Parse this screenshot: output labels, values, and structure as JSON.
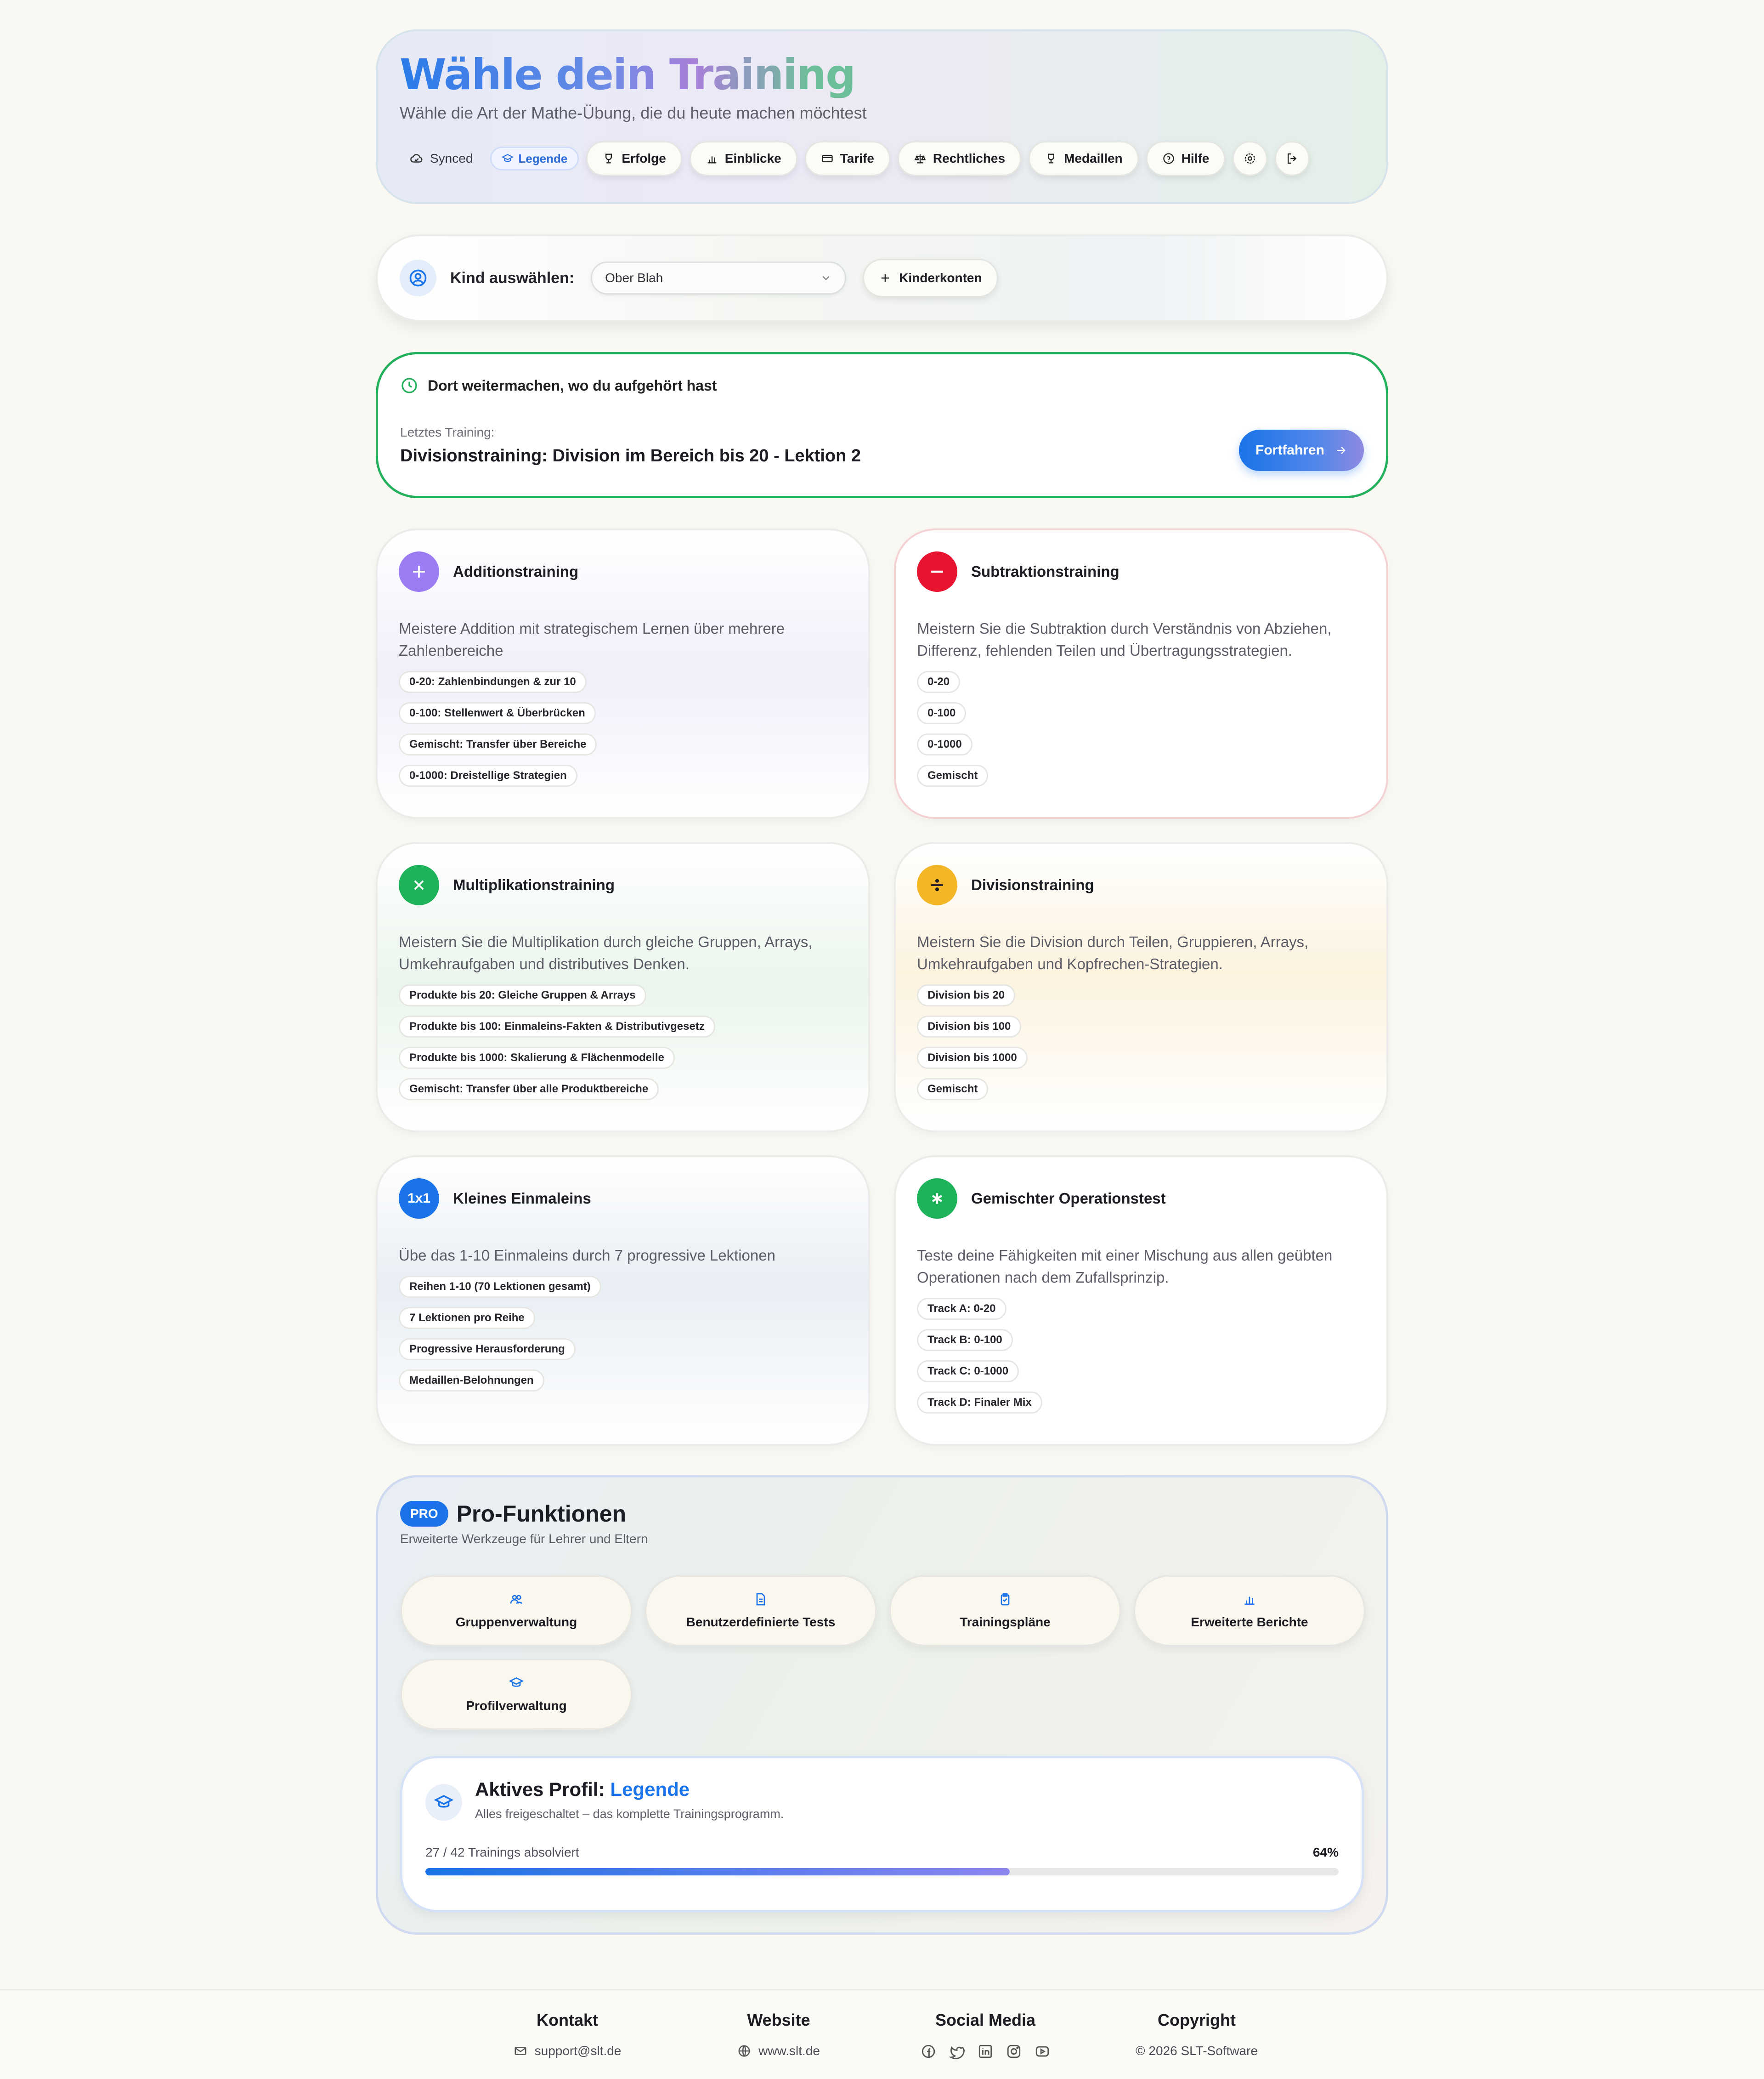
{
  "header": {
    "title": "Wähle dein Training",
    "subtitle": "Wähle die Art der Mathe-Übung, die du heute machen möchtest",
    "synced_label": "Synced",
    "legende_label": "Legende",
    "nav": {
      "erfolge": "Erfolge",
      "einblicke": "Einblicke",
      "tarife": "Tarife",
      "rechtliches": "Rechtliches",
      "medaillen": "Medaillen",
      "hilfe": "Hilfe"
    }
  },
  "child_select": {
    "label": "Kind auswählen:",
    "selected": "Ober Blah",
    "kinderkonten_label": "Kinderkonten"
  },
  "resume": {
    "heading": "Dort weitermachen, wo du aufgehört hast",
    "last_label": "Letztes Training:",
    "last_title": "Divisionstraining: Division im Bereich bis 20 - Lektion 2",
    "continue_label": "Fortfahren"
  },
  "trainings": [
    {
      "title": "Additionstraining",
      "description": "Meistere Addition mit strategischem Lernen über mehrere Zahlenbereiche",
      "chips": [
        "0-20: Zahlenbindungen & zur 10",
        "0-100: Stellenwert & Überbrücken",
        "Gemischt: Transfer über Bereiche",
        "0-1000: Dreistellige Strategien"
      ]
    },
    {
      "title": "Subtraktionstraining",
      "description": "Meistern Sie die Subtraktion durch Verständnis von Abziehen, Differenz, fehlenden Teilen und Übertragungsstrategien.",
      "chips": [
        "0-20",
        "0-100",
        "0-1000",
        "Gemischt"
      ]
    },
    {
      "title": "Multiplikationstraining",
      "description": "Meistern Sie die Multiplikation durch gleiche Gruppen, Arrays, Umkehraufgaben und distributives Denken.",
      "chips": [
        "Produkte bis 20: Gleiche Gruppen & Arrays",
        "Produkte bis 100: Einmaleins-Fakten & Distributivgesetz",
        "Produkte bis 1000: Skalierung & Flächenmodelle",
        "Gemischt: Transfer über alle Produktbereiche"
      ]
    },
    {
      "title": "Divisionstraining",
      "description": "Meistern Sie die Division durch Teilen, Gruppieren, Arrays, Umkehraufgaben und Kopfrechen-Strategien.",
      "chips": [
        "Division bis 20",
        "Division bis 100",
        "Division bis 1000",
        "Gemischt"
      ]
    },
    {
      "title": "Kleines Einmaleins",
      "icon_text": "1x1",
      "description": "Übe das 1-10 Einmaleins durch 7 progressive Lektionen",
      "chips": [
        "Reihen 1-10 (70 Lektionen gesamt)",
        "7 Lektionen pro Reihe",
        "Progressive Herausforderung",
        "Medaillen-Belohnungen"
      ]
    },
    {
      "title": "Gemischter Operationstest",
      "description": "Teste deine Fähigkeiten mit einer Mischung aus allen geübten Operationen nach dem Zufallsprinzip.",
      "chips": [
        "Track A: 0-20",
        "Track B: 0-100",
        "Track C: 0-1000",
        "Track D: Finaler Mix"
      ]
    }
  ],
  "pro": {
    "badge": "PRO",
    "title": "Pro-Funktionen",
    "subtitle": "Erweiterte Werkzeuge für Lehrer und Eltern",
    "items": [
      "Gruppenverwaltung",
      "Benutzerdefinierte Tests",
      "Trainingspläne",
      "Erweiterte Berichte",
      "Profilverwaltung"
    ]
  },
  "profile": {
    "label": "Aktives Profil:",
    "name": "Legende",
    "description": "Alles freigeschaltet – das komplette Trainingsprogramm.",
    "progress_text": "27 / 42 Trainings absolviert",
    "progress_percent_label": "64%",
    "progress_fraction": 0.64
  },
  "footer": {
    "kontakt": {
      "heading": "Kontakt",
      "value": "support@slt.de"
    },
    "website": {
      "heading": "Website",
      "value": "www.slt.de"
    },
    "social": {
      "heading": "Social Media"
    },
    "copyright": {
      "heading": "Copyright",
      "value": "© 2026 SLT-Software"
    }
  },
  "colors": {
    "accent": "#1a73e8",
    "resume_border": "#22b05c",
    "addition": "#9b7cf2",
    "subtraction": "#e8132f",
    "multiplication": "#1eb35b",
    "division": "#f2b627",
    "einmaleins": "#1a73e8",
    "mixed": "#1eb35b"
  }
}
